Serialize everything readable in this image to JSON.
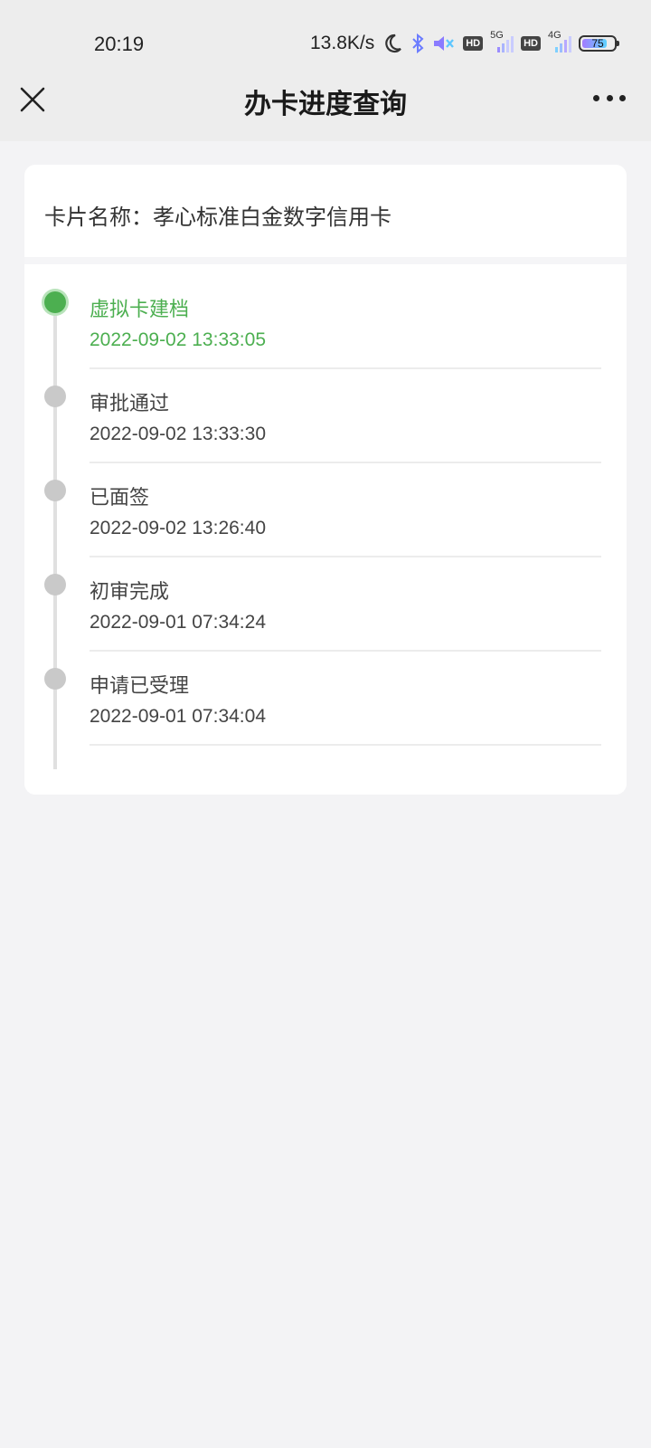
{
  "status_bar": {
    "time": "20:19",
    "net_speed": "13.8K/s",
    "hd_badge": "HD",
    "net_gen_1": "5G",
    "net_gen_2": "4G",
    "battery_level": "75",
    "icons": [
      "moon-icon",
      "bluetooth-icon",
      "mute-icon",
      "signal-icon",
      "battery-icon"
    ]
  },
  "nav": {
    "title": "办卡进度查询",
    "close_icon": "close-icon",
    "more_icon": "more-icon"
  },
  "card": {
    "label": "卡片名称：孝心标准白金数字信用卡"
  },
  "timeline": {
    "accent_color": "#4caf50",
    "steps": [
      {
        "name": "虚拟卡建档",
        "time": "2022-09-02 13:33:05",
        "active": true
      },
      {
        "name": "审批通过",
        "time": "2022-09-02 13:33:30",
        "active": false
      },
      {
        "name": "已面签",
        "time": "2022-09-02 13:26:40",
        "active": false
      },
      {
        "name": "初审完成",
        "time": "2022-09-01 07:34:24",
        "active": false
      },
      {
        "name": "申请已受理",
        "time": "2022-09-01 07:34:04",
        "active": false
      }
    ]
  }
}
